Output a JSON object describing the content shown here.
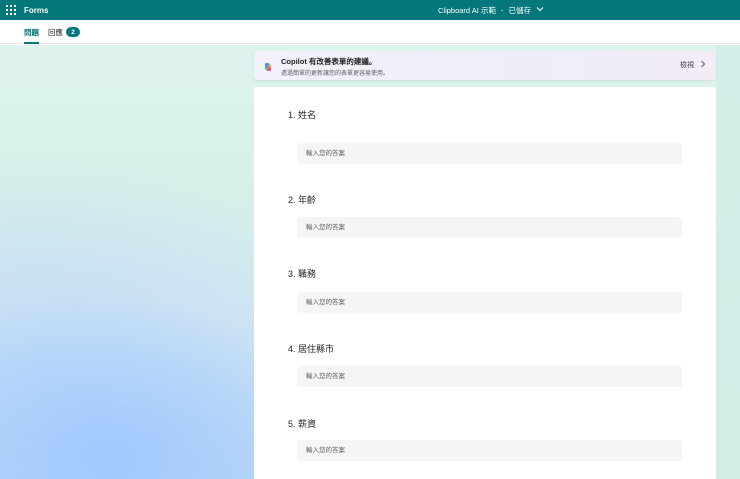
{
  "app": {
    "name": "Forms",
    "doc_title": "Clipboard AI 示範",
    "separator": "-",
    "save_status": "已儲存",
    "theme_color": "#03787c"
  },
  "tabs": [
    {
      "label": "問題",
      "active": true
    },
    {
      "label": "回應",
      "badge": "2",
      "active": false
    }
  ],
  "copilot": {
    "title": "Copilot 有改善表單的建議。",
    "description": "透過簡單的更新讓您的表單更容易使用。",
    "view_label": "檢視"
  },
  "questions": [
    {
      "title": "1. 姓名",
      "placeholder": "輸入您的答案"
    },
    {
      "title": "2. 年齡",
      "placeholder": "輸入您的答案"
    },
    {
      "title": "3. 職務",
      "placeholder": "輸入您的答案"
    },
    {
      "title": "4. 居住縣市",
      "placeholder": "輸入您的答案"
    },
    {
      "title": "5. 薪資",
      "placeholder": "輸入您的答案"
    }
  ]
}
